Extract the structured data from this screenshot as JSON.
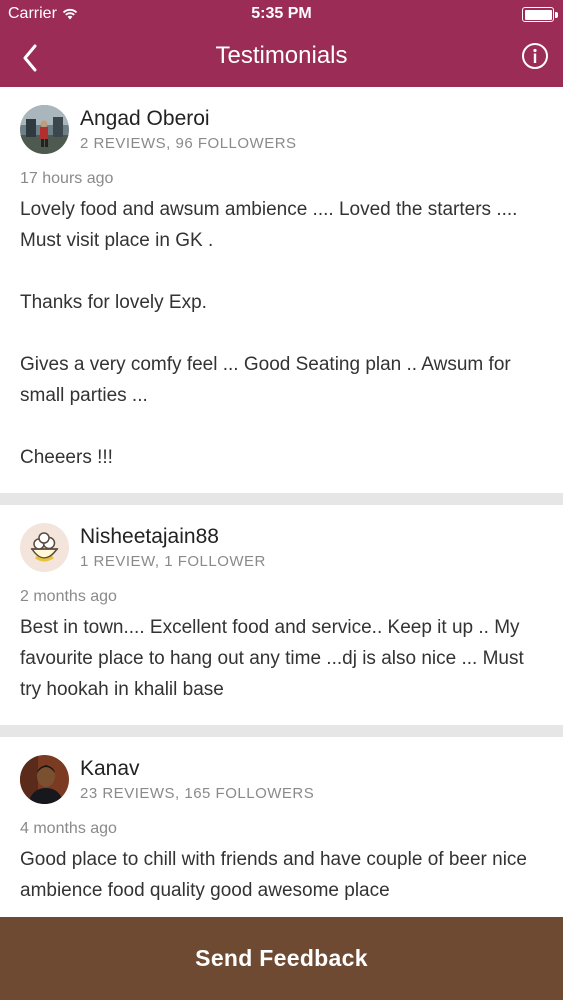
{
  "status_bar": {
    "carrier": "Carrier",
    "time": "5:35 PM"
  },
  "nav": {
    "title": "Testimonials",
    "back_icon": "chevron-left-icon",
    "info_icon": "info-circle-icon"
  },
  "reviews": [
    {
      "name": "Angad Oberoi",
      "stats": "2 REVIEWS, 96 FOLLOWERS",
      "time_ago": "17 hours ago",
      "text": "Lovely food and awsum ambience .... Loved the starters .... Must visit place in GK .\n\nThanks for lovely Exp.\n\nGives a very comfy feel ... Good Seating plan .. Awsum for small parties ...\n\nCheeers !!!"
    },
    {
      "name": "Nisheetajain88",
      "stats": "1 REVIEW, 1 FOLLOWER",
      "time_ago": "2 months ago",
      "text": "Best in town.... Excellent food and service.. Keep it up .. My favourite place to hang out any time ...dj is also nice ... Must try hookah in khalil base"
    },
    {
      "name": "Kanav",
      "stats": "23 REVIEWS, 165 FOLLOWERS",
      "time_ago": "4 months ago",
      "text": "Good place to chill with friends and have couple of beer nice ambience food quality good awesome place"
    }
  ],
  "footer": {
    "send_feedback_label": "Send Feedback"
  },
  "colors": {
    "header": "#9b2c55",
    "footer": "#6f4a33",
    "separator": "#e6e6e6"
  }
}
